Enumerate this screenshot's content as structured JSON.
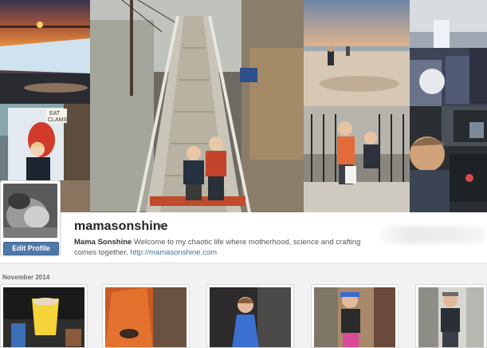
{
  "profile": {
    "username": "mamasonshine",
    "full_name": "Mama Sonshine",
    "bio": "Welcome to my chaotic life where motherhood, science and crafting comes together.",
    "website": "http://mamasonshine.com",
    "edit_button_label": "Edit Profile"
  },
  "feed": {
    "month_label": "November 2014"
  },
  "colors": {
    "edit_button": "#4f78a8",
    "link": "#3f729b"
  },
  "icons": {
    "dropdown": "chevron-down-icon"
  }
}
